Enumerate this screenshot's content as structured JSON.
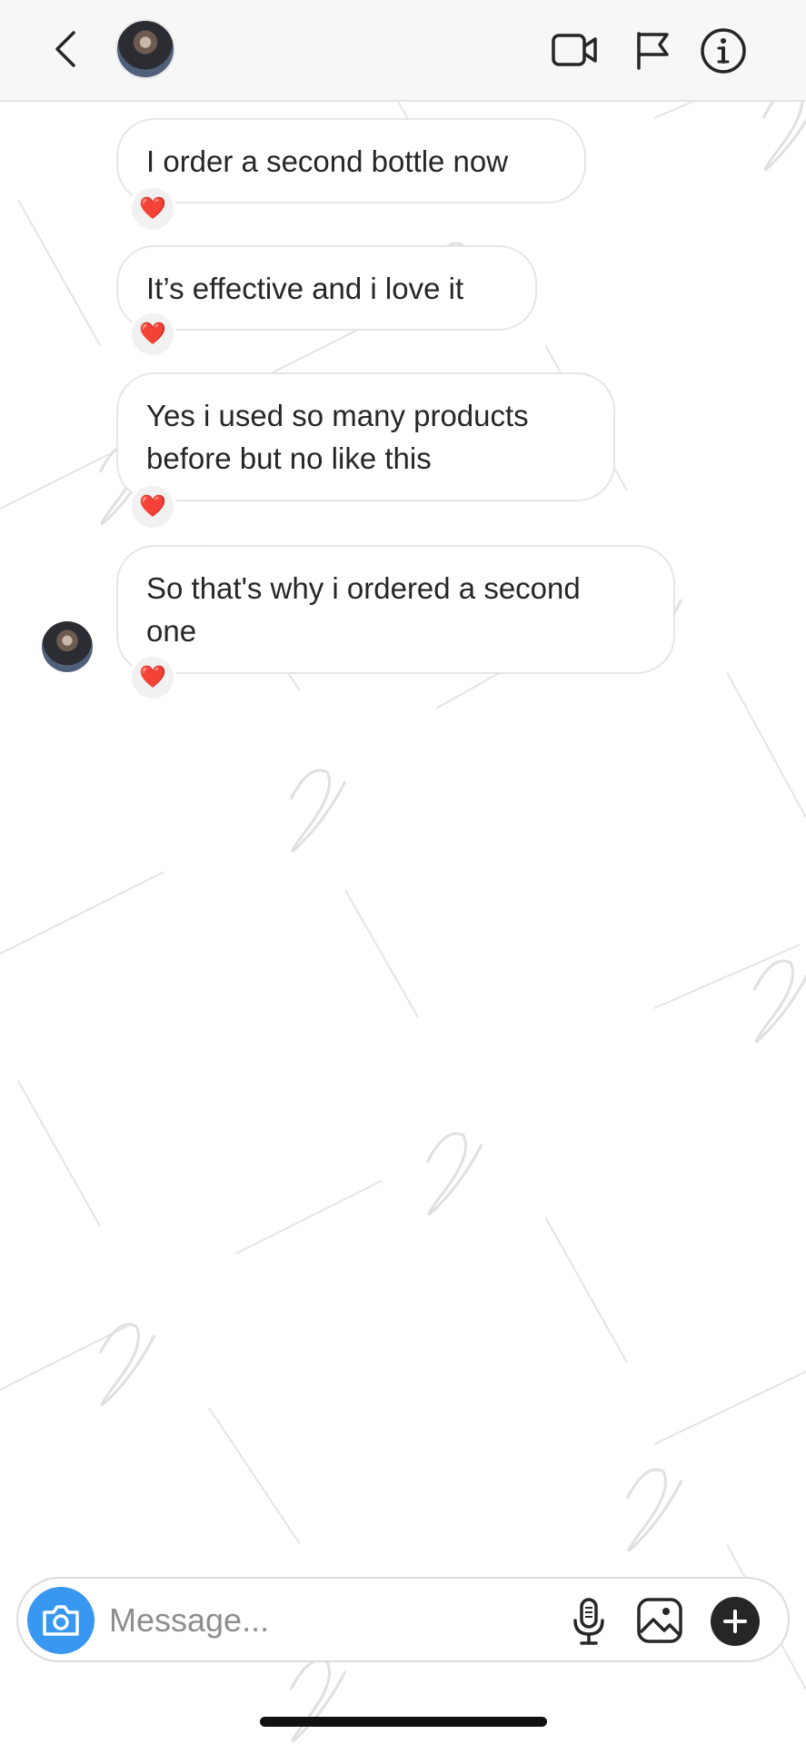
{
  "header": {
    "back_icon": "chevron-left-icon",
    "video_icon": "video-camera-icon",
    "flag_icon": "flag-icon",
    "info_icon": "info-icon"
  },
  "messages": [
    {
      "text": "I order a second bottle now",
      "reaction": "❤️"
    },
    {
      "text": "It’s effective and i love it",
      "reaction": "❤️"
    },
    {
      "line1": "Yes i used so many products",
      "line2": "before but no like this",
      "reaction": "❤️"
    },
    {
      "line1": "So that's why i ordered a second",
      "line2": "one",
      "reaction": "❤️"
    }
  ],
  "composer": {
    "placeholder": "Message...",
    "camera_icon": "camera-icon",
    "mic_icon": "microphone-icon",
    "gallery_icon": "image-icon",
    "plus_icon": "plus-icon"
  },
  "colors": {
    "accent": "#3897f0",
    "reaction_heart": "#ed4956",
    "bubble_border": "#e6e6e6"
  }
}
